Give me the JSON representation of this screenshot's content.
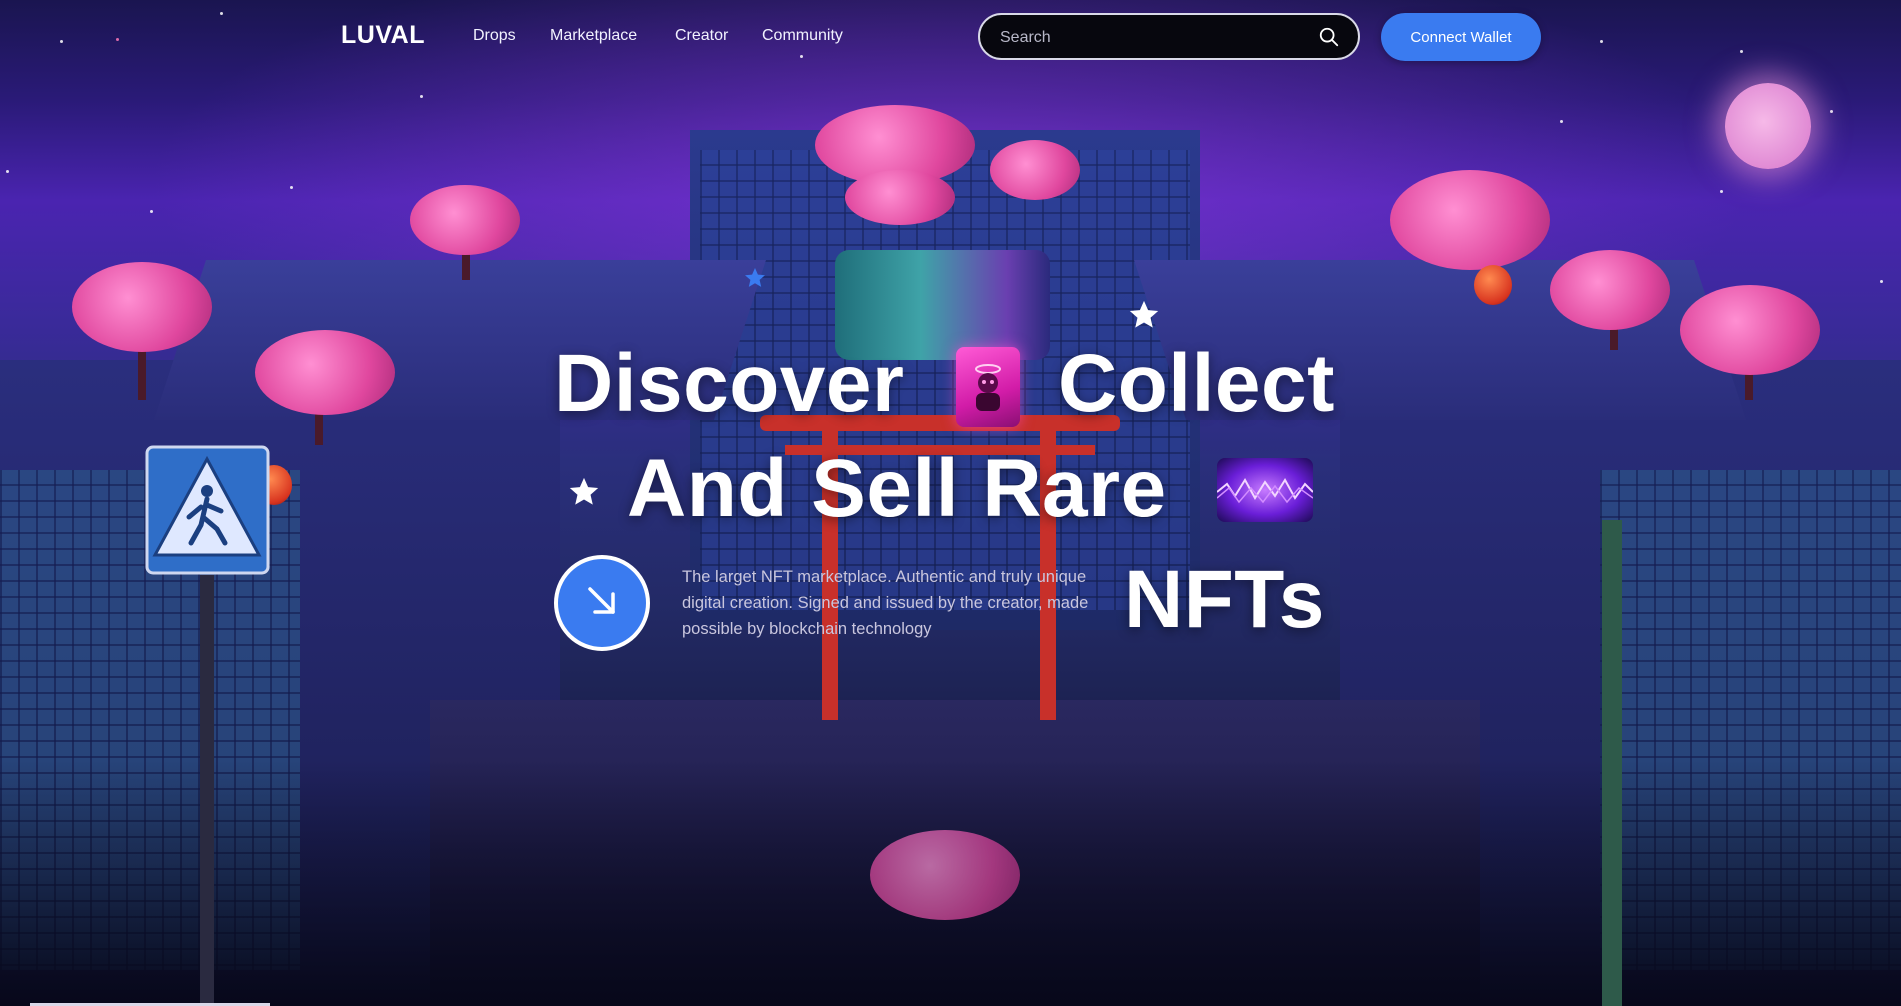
{
  "nav": {
    "logo": "LUVAL",
    "links": [
      "Drops",
      "Marketplace",
      "Creator",
      "Community"
    ]
  },
  "search": {
    "placeholder": "Search",
    "icon": "search-icon"
  },
  "connect_wallet": {
    "label": "Connect Wallet"
  },
  "hero": {
    "line1_word1": "Discover",
    "line1_word2": "Collect",
    "line2": "And Sell Rare",
    "line3": "NFTs",
    "description": "The larget NFT marketplace. Authentic and truly unique digital creation. Signed and issued by the creator, made possible by blockchain technology",
    "cta_icon": "arrow-down-right-icon"
  },
  "colors": {
    "accent": "#3a7bf0",
    "background": "#1a1550",
    "text": "#ffffff",
    "muted_text": "#c9c6de"
  }
}
